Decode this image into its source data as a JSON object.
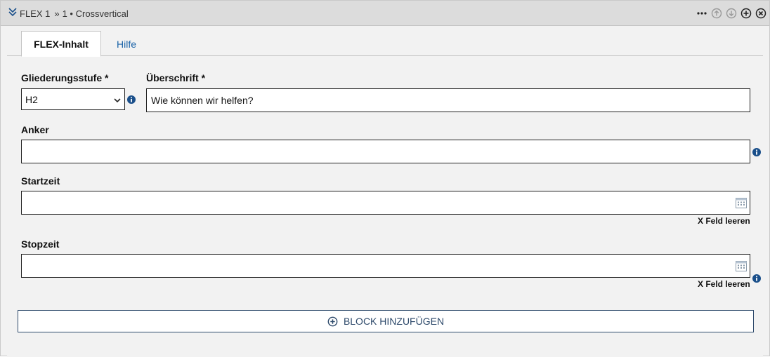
{
  "titlebar": {
    "flex_label": "FLEX 1",
    "separator": "»",
    "item_label": "1 • Crossvertical",
    "icons": [
      "collapse-icon",
      "more-icon",
      "move-up-icon",
      "move-down-icon",
      "add-icon",
      "close-icon"
    ]
  },
  "tabs": [
    {
      "label": "FLEX-Inhalt",
      "active": true
    },
    {
      "label": "Hilfe",
      "active": false
    }
  ],
  "form": {
    "level": {
      "label": "Gliederungsstufe *",
      "value": "H2"
    },
    "heading": {
      "label": "Überschrift *",
      "value": "Wie können wir helfen?"
    },
    "anchor": {
      "label": "Anker",
      "value": ""
    },
    "start": {
      "label": "Startzeit",
      "value": "",
      "clear_label": "X Feld leeren"
    },
    "stop": {
      "label": "Stopzeit",
      "value": "",
      "clear_label": "X Feld leeren"
    }
  },
  "add_block": {
    "label": "BLOCK HINZUFÜGEN"
  },
  "colors": {
    "link": "#1a63a8",
    "info": "#1a4f8a",
    "button_border": "#2e4a6b",
    "titlebar_bg": "#dcdcdc"
  }
}
